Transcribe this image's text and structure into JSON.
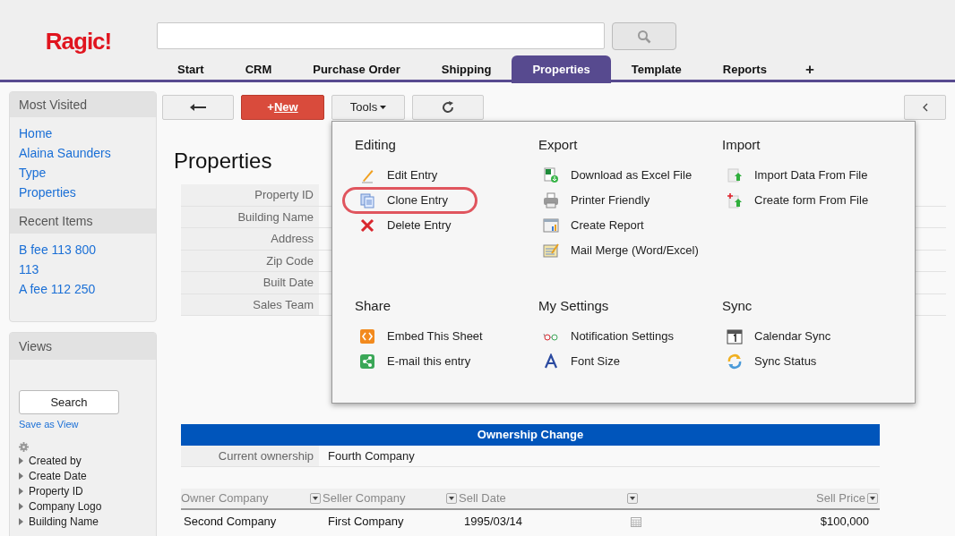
{
  "logo": "Ragic!",
  "tabs": [
    {
      "label": "Start",
      "selected": false
    },
    {
      "label": "CRM",
      "selected": false
    },
    {
      "label": "Purchase Order",
      "selected": false
    },
    {
      "label": "Shipping",
      "selected": false
    },
    {
      "label": "Properties",
      "selected": true
    },
    {
      "label": "Template",
      "selected": false
    },
    {
      "label": "Reports",
      "selected": false
    }
  ],
  "add_tab": "+",
  "sidebar": [
    {
      "title": "Most Visited",
      "items": [
        "Home",
        "Alaina Saunders",
        "Type",
        "Properties"
      ]
    },
    {
      "title": "Recent Items",
      "items": [
        "B fee 113 800",
        "113",
        "A fee 112 250"
      ]
    }
  ],
  "views": {
    "title": "Views",
    "search_button": "Search",
    "save_link": "Save as View",
    "fields": [
      "Created by",
      "Create Date",
      "Property ID",
      "Company Logo",
      "Building Name"
    ]
  },
  "toolbar": {
    "new_prefix": "+",
    "new_label": "New",
    "tools": "Tools"
  },
  "page_title": "Properties",
  "form": [
    {
      "label": "Property ID"
    },
    {
      "label": "Building Name"
    },
    {
      "label": "Address"
    },
    {
      "label": "Zip Code"
    },
    {
      "label": "Built Date"
    },
    {
      "label": "Sales Team"
    }
  ],
  "menu": [
    {
      "title": "Editing",
      "items": [
        {
          "label": "Edit Entry",
          "circled": false
        },
        {
          "label": "Clone Entry",
          "circled": true
        },
        {
          "label": "Delete Entry",
          "circled": false
        }
      ]
    },
    {
      "title": "Export",
      "items": [
        {
          "label": "Download as Excel File",
          "circled": false
        },
        {
          "label": "Printer Friendly",
          "circled": false
        },
        {
          "label": "Create Report",
          "circled": false
        },
        {
          "label": "Mail Merge (Word/Excel)",
          "circled": false
        }
      ]
    },
    {
      "title": "Import",
      "items": [
        {
          "label": "Import Data From File",
          "circled": false
        },
        {
          "label": "Create form From File",
          "circled": false
        }
      ]
    },
    {
      "title": "Share",
      "items": [
        {
          "label": "Embed This Sheet",
          "circled": false
        },
        {
          "label": "E-mail this entry",
          "circled": false
        }
      ]
    },
    {
      "title": "My Settings",
      "items": [
        {
          "label": "Notification Settings",
          "circled": false
        },
        {
          "label": "Font Size",
          "circled": false
        }
      ]
    },
    {
      "title": "Sync",
      "items": [
        {
          "label": "Calendar Sync",
          "circled": false
        },
        {
          "label": "Sync Status",
          "circled": false
        }
      ]
    }
  ],
  "ownership": {
    "title": "Ownership Change",
    "current_label": "Current ownership",
    "current_value": "Fourth Company"
  },
  "table": {
    "columns": [
      "Owner Company",
      "Seller Company",
      "Sell Date",
      "Sell Price"
    ],
    "rows": [
      {
        "owner": "Second Company",
        "seller": "First Company",
        "sell_date": "1995/03/14",
        "sell_price": "$100,000"
      }
    ]
  }
}
